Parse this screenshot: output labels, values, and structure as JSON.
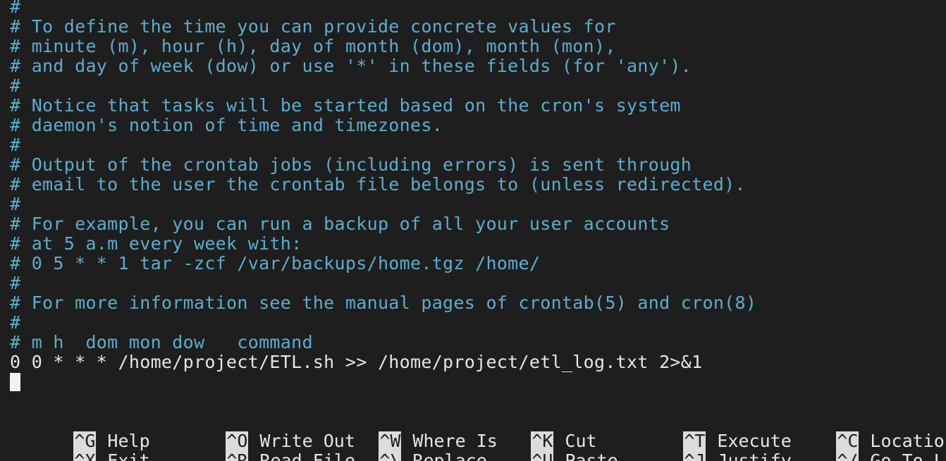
{
  "editor": {
    "lines": [
      {
        "text": "#",
        "kind": "comment"
      },
      {
        "text": "# To define the time you can provide concrete values for",
        "kind": "comment"
      },
      {
        "text": "# minute (m), hour (h), day of month (dom), month (mon),",
        "kind": "comment"
      },
      {
        "text": "# and day of week (dow) or use '*' in these fields (for 'any').",
        "kind": "comment"
      },
      {
        "text": "#",
        "kind": "comment"
      },
      {
        "text": "# Notice that tasks will be started based on the cron's system",
        "kind": "comment"
      },
      {
        "text": "# daemon's notion of time and timezones.",
        "kind": "comment"
      },
      {
        "text": "#",
        "kind": "comment"
      },
      {
        "text": "# Output of the crontab jobs (including errors) is sent through",
        "kind": "comment"
      },
      {
        "text": "# email to the user the crontab file belongs to (unless redirected).",
        "kind": "comment"
      },
      {
        "text": "#",
        "kind": "comment"
      },
      {
        "text": "# For example, you can run a backup of all your user accounts",
        "kind": "comment"
      },
      {
        "text": "# at 5 a.m every week with:",
        "kind": "comment"
      },
      {
        "text": "# 0 5 * * 1 tar -zcf /var/backups/home.tgz /home/",
        "kind": "comment"
      },
      {
        "text": "#",
        "kind": "comment"
      },
      {
        "text": "# For more information see the manual pages of crontab(5) and cron(8)",
        "kind": "comment"
      },
      {
        "text": "#",
        "kind": "comment"
      },
      {
        "text": "# m h  dom mon dow   command",
        "kind": "comment"
      },
      {
        "text": "0 0 * * * /home/project/ETL.sh >> /home/project/etl_log.txt 2>&1",
        "kind": "code"
      }
    ]
  },
  "shortcuts": [
    {
      "key": "^G",
      "label": "Help"
    },
    {
      "key": "^O",
      "label": "Write Out"
    },
    {
      "key": "^W",
      "label": "Where Is"
    },
    {
      "key": "^K",
      "label": "Cut"
    },
    {
      "key": "^T",
      "label": "Execute"
    },
    {
      "key": "^C",
      "label": "Location"
    },
    {
      "key": "^X",
      "label": "Exit"
    },
    {
      "key": "^R",
      "label": "Read File"
    },
    {
      "key": "^\\",
      "label": "Replace"
    },
    {
      "key": "^U",
      "label": "Paste"
    },
    {
      "key": "^J",
      "label": "Justify"
    },
    {
      "key": "^/",
      "label": "Go To Line"
    }
  ],
  "colors": {
    "background": "#1e1e1e",
    "comment": "#5aaed0",
    "text": "#e6e6e6",
    "key_bg": "#dcdcdc"
  }
}
